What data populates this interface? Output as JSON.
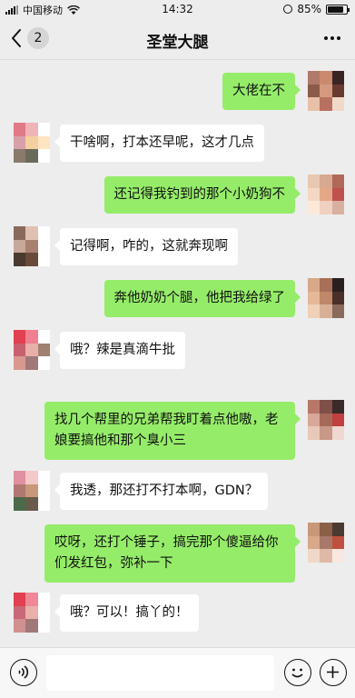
{
  "status_bar": {
    "carrier": "中国移动",
    "time": "14:32",
    "battery": "85%",
    "battery_level": 0.85
  },
  "nav": {
    "back_count": "2",
    "title": "圣堂大腿"
  },
  "messages": [
    {
      "side": "right",
      "text": "大佬在不",
      "avatar_colors": [
        "#b07a6a",
        "#c98a6e",
        "#3a2522",
        "#8c5a4a",
        "#d49a80",
        "#6a3a30",
        "#e8c0a8",
        "#b87060",
        "#f2d8c8"
      ]
    },
    {
      "side": "left",
      "text": "干啥啊，打本还早呢，这才几点",
      "avatar_colors": [
        "#e07a86",
        "#f0b4b8",
        "#ffffff",
        "#d8a0a8",
        "#f4d0a0",
        "#ffe4c0",
        "#8a7a6a",
        "#6a6a5a",
        "#ffffff"
      ]
    },
    {
      "side": "right",
      "text": "还记得我钓到的那个小奶狗不",
      "avatar_colors": [
        "#e8c8b0",
        "#d8a890",
        "#b06858",
        "#f4d8c4",
        "#e4a888",
        "#c05050",
        "#fce8d8",
        "#f0d0c0",
        "#d8b0a0"
      ]
    },
    {
      "side": "left",
      "text": "记得啊，咋的，这就奔现啊",
      "avatar_colors": [
        "#8a6a5a",
        "#e0c0b0",
        "#ffffff",
        "#c8a898",
        "#a88070",
        "#ffffff",
        "#4a3a30",
        "#6a4a3a",
        "#ffffff"
      ]
    },
    {
      "side": "right",
      "text": "奔他奶奶个腿，他把我给绿了",
      "avatar_colors": [
        "#d8a888",
        "#a87058",
        "#2a2020",
        "#e4b898",
        "#c08868",
        "#4a3028",
        "#f0d0b8",
        "#d8b098",
        "#8a6a5a"
      ]
    },
    {
      "side": "left",
      "text": "哦？辣是真滴牛批",
      "avatar_colors": [
        "#e04050",
        "#f08090",
        "#ffffff",
        "#c86070",
        "#e8b0a8",
        "#a08070",
        "#d89890",
        "#a07878",
        "#ffffff"
      ]
    },
    {
      "side": "right",
      "text": "找几个帮里的兄弟帮我盯着点他嗷，老娘要搞他和那个臭小三",
      "avatar_colors": [
        "#b87868",
        "#805048",
        "#3a2a2a",
        "#d8a898",
        "#a86858",
        "#c04040",
        "#e8c8b8",
        "#c89888",
        "#f0d8d0"
      ]
    },
    {
      "side": "left",
      "text": "我透，那还打不打本啊，GDN？",
      "avatar_colors": [
        "#e090a0",
        "#f4c8c8",
        "#ffffff",
        "#b07870",
        "#c89878",
        "#ffffff",
        "#4a6a4a",
        "#6a5a4a",
        "#ffffff"
      ]
    },
    {
      "side": "right",
      "text": "哎呀，还打个锤子，搞完那个傻逼给你们发红包，弥补一下",
      "avatar_colors": [
        "#c89878",
        "#8a6048",
        "#4a3a30",
        "#d8a888",
        "#a87868",
        "#c05040",
        "#f0d8c8",
        "#e0b8a8",
        "#f8e8e0"
      ]
    },
    {
      "side": "left",
      "text": "哦？可以！搞丫的！",
      "avatar_colors": [
        "#e04050",
        "#f08898",
        "#ffffff",
        "#c86878",
        "#e8b0a8",
        "#ffffff",
        "#d09090",
        "#a07878",
        "#ffffff"
      ]
    }
  ],
  "input": {
    "placeholder": ""
  }
}
